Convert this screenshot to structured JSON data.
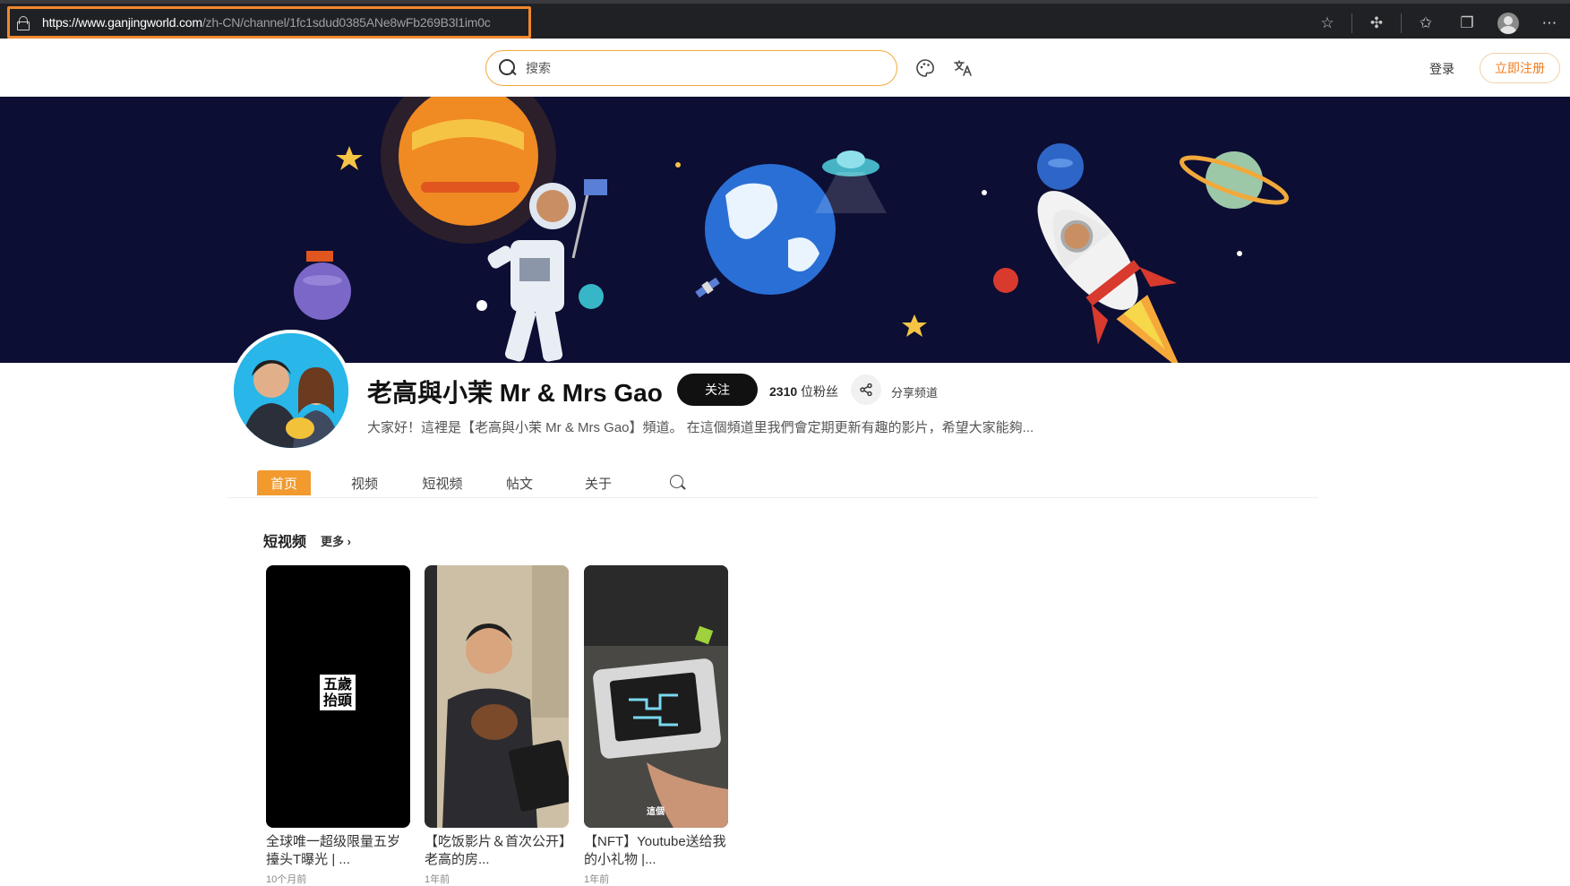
{
  "browser": {
    "url_host": "https://www.ganjingworld.com",
    "url_path": "/zh-CN/channel/1fc1sdud0385ANe8wFb269B3l1im0c",
    "icons": [
      "star-add-icon",
      "extensions-icon",
      "favorites-icon",
      "collections-icon",
      "profile-icon",
      "more-icon"
    ]
  },
  "header": {
    "search_placeholder": "搜索",
    "login_label": "登录",
    "register_label": "立即注册"
  },
  "channel": {
    "name": "老高與小茉 Mr & Mrs Gao",
    "follow_label": "关注",
    "fans_count": "2310",
    "fans_suffix": " 位粉丝",
    "share_label": "分享频道",
    "description": "大家好！這裡是【老高與小茉 Mr & Mrs Gao】頻道。 在這個頻道里我們會定期更新有趣的影片，希望大家能夠..."
  },
  "tabs": [
    {
      "label": "首页",
      "active": true
    },
    {
      "label": "视频",
      "active": false
    },
    {
      "label": "短视频",
      "active": false
    },
    {
      "label": "帖文",
      "active": false
    },
    {
      "label": "关于",
      "active": false
    }
  ],
  "shorts": {
    "title": "短视频",
    "more_label": "更多",
    "items": [
      {
        "title": "全球唯一超级限量五岁擡头T曝光 | ...",
        "time": "10个月前",
        "thumb_text": "五歲抬頭"
      },
      {
        "title": "【吃饭影片＆首次公开】老高的房...",
        "time": "1年前"
      },
      {
        "title": "【NFT】Youtube送给我的小礼物 |...",
        "time": "1年前",
        "thumb_text": "這個"
      }
    ]
  },
  "colors": {
    "accent": "#f29a2e",
    "banner_bg": "#0c0e33",
    "url_highlight": "#f0882e"
  }
}
